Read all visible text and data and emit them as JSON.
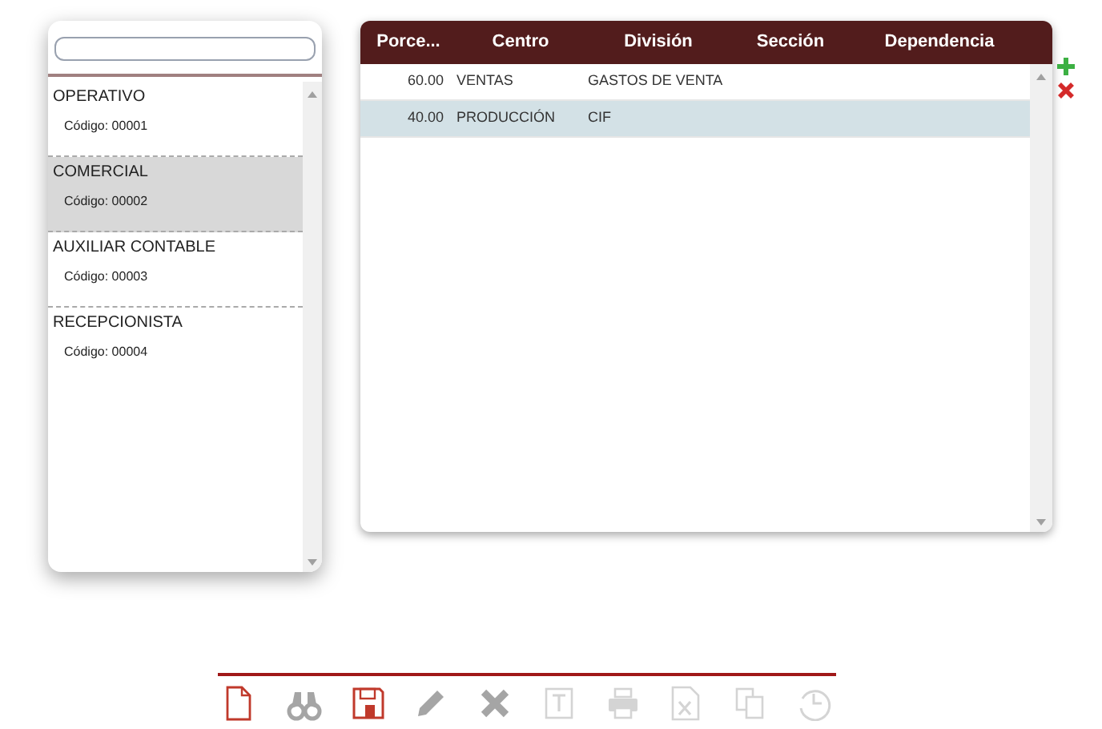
{
  "list_panel": {
    "items": [
      {
        "title": "OPERATIVO",
        "code": "Código: 00001",
        "selected": false
      },
      {
        "title": "COMERCIAL",
        "code": "Código: 00002",
        "selected": true
      },
      {
        "title": "AUXILIAR CONTABLE",
        "code": "Código: 00003",
        "selected": false
      },
      {
        "title": "RECEPCIONISTA",
        "code": "Código: 00004",
        "selected": false
      }
    ]
  },
  "table": {
    "columns": [
      "Porce...",
      "Centro",
      "División",
      "Sección",
      "Dependencia"
    ],
    "rows": [
      {
        "cells": [
          "60.00",
          "VENTAS",
          "GASTOS DE VENTA",
          "",
          ""
        ],
        "selected": false
      },
      {
        "cells": [
          "40.00",
          "PRODUCCIÓN",
          "CIF",
          "",
          ""
        ],
        "selected": true
      }
    ]
  },
  "row_actions": [
    {
      "kind": "add"
    },
    {
      "kind": "remove"
    }
  ],
  "toolbar": [
    {
      "kind": "new",
      "accent": true,
      "disabled": false
    },
    {
      "kind": "search",
      "accent": false,
      "disabled": false
    },
    {
      "kind": "save",
      "accent": true,
      "disabled": false
    },
    {
      "kind": "edit",
      "accent": false,
      "disabled": false
    },
    {
      "kind": "delete",
      "accent": false,
      "disabled": false
    },
    {
      "kind": "text",
      "accent": false,
      "disabled": true
    },
    {
      "kind": "print",
      "accent": false,
      "disabled": true
    },
    {
      "kind": "excel",
      "accent": false,
      "disabled": true
    },
    {
      "kind": "copy",
      "accent": false,
      "disabled": true
    },
    {
      "kind": "history",
      "accent": false,
      "disabled": true
    }
  ]
}
